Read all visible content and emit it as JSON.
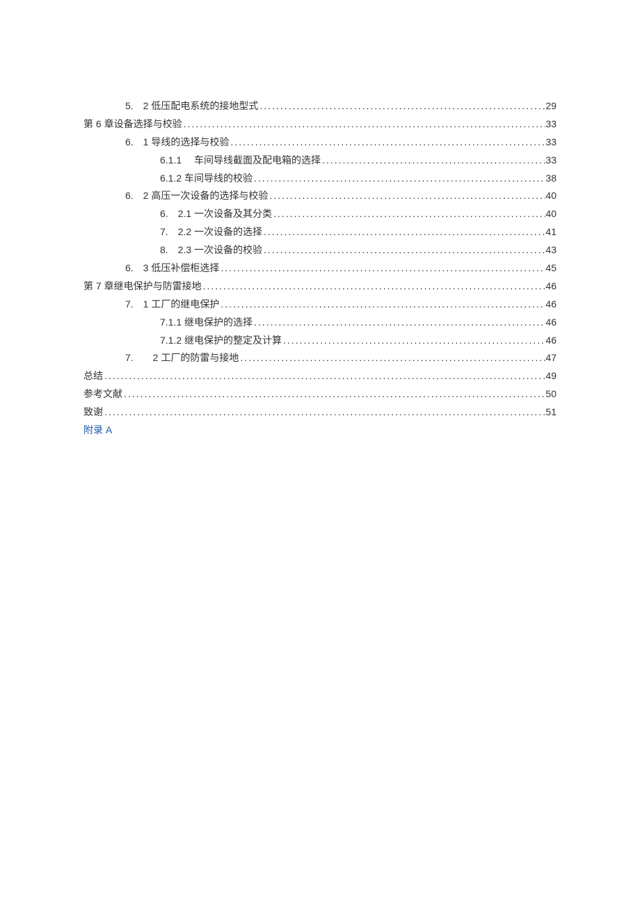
{
  "toc": [
    {
      "indent": 1,
      "label": "5.　2 低压配电系统的接地型式",
      "page": "29"
    },
    {
      "indent": 0,
      "label": "第 6 章设备选择与校验",
      "page": "33"
    },
    {
      "indent": 1,
      "label": "6.　1 导线的选择与校验",
      "page": "33"
    },
    {
      "indent": 2,
      "label": "6.1.1　 车间导线截面及配电箱的选择",
      "page": "33"
    },
    {
      "indent": 2,
      "label": "6.1.2 车间导线的校验",
      "page": "38"
    },
    {
      "indent": 1,
      "label": "6.　2 高压一次设备的选择与校验",
      "page": "40"
    },
    {
      "indent": 2,
      "label": "6.　2.1 一次设备及其分类",
      "page": "40"
    },
    {
      "indent": 2,
      "label": "7.　2.2 一次设备的选择",
      "page": "41"
    },
    {
      "indent": 2,
      "label": "8.　2.3 一次设备的校验",
      "page": "43"
    },
    {
      "indent": 1,
      "label": "6.　3 低压补偿柜选择",
      "page": "45"
    },
    {
      "indent": 0,
      "label": "第 7 章继电保护与防雷接地",
      "page": "46"
    },
    {
      "indent": 1,
      "label": "7.　1 工厂的继电保护",
      "page": "46"
    },
    {
      "indent": 2,
      "label": "7.1.1 继电保护的选择",
      "page": "46"
    },
    {
      "indent": 2,
      "label": "7.1.2 继电保护的整定及计算",
      "page": "46"
    },
    {
      "indent": 1,
      "label": "7.　　2 工厂的防雷与接地",
      "page": "47"
    },
    {
      "indent": 0,
      "label": "总结",
      "page": "49"
    },
    {
      "indent": 0,
      "label": "参考文献",
      "page": "50"
    },
    {
      "indent": 0,
      "label": "致谢",
      "page": "51"
    }
  ],
  "appendix": "附录 A"
}
